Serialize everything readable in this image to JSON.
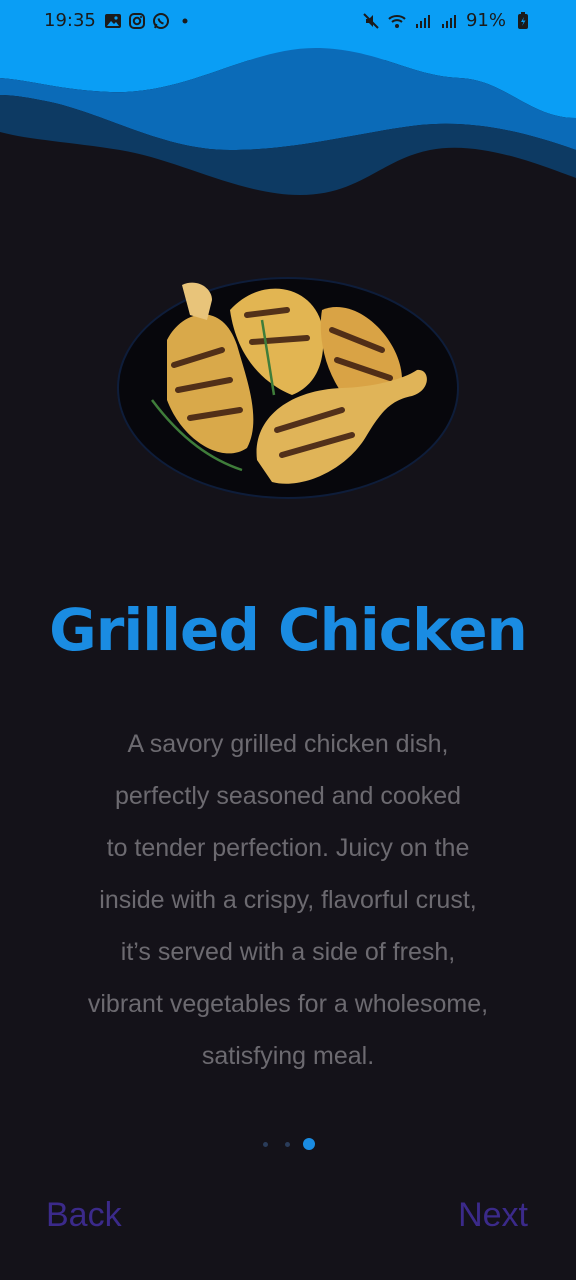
{
  "status_bar": {
    "time": "19:35",
    "left_icons": [
      "gallery-icon",
      "instagram-icon",
      "whatsapp-icon",
      "dot-icon"
    ],
    "right_icons": [
      "mute-icon",
      "wifi-icon",
      "signal-icon",
      "signal-icon",
      "battery-icon"
    ],
    "battery": "91%"
  },
  "colors": {
    "background": "#141219",
    "wave_light": "#0a9ef5",
    "wave_mid": "#0b6bb8",
    "wave_dark": "#0d3a63",
    "title": "#1a8ce2",
    "description": "#6c6a70",
    "nav_buttons": "#3b2a8a",
    "dot_active": "#1a8ce2",
    "dot_inactive": "#2a3c5a"
  },
  "main": {
    "image_icon": "grilled-chicken-dish",
    "title": "Grilled Chicken",
    "description_lines": [
      "A savory grilled chicken dish,",
      "perfectly seasoned and cooked",
      "to tender perfection. Juicy on the",
      "inside with a crispy, flavorful crust,",
      "it’s served with a side of fresh,",
      "vibrant vegetables for a wholesome,",
      "satisfying meal."
    ]
  },
  "pagination": {
    "total": 3,
    "active": 3
  },
  "navigation": {
    "back_label": "Back",
    "next_label": "Next"
  }
}
